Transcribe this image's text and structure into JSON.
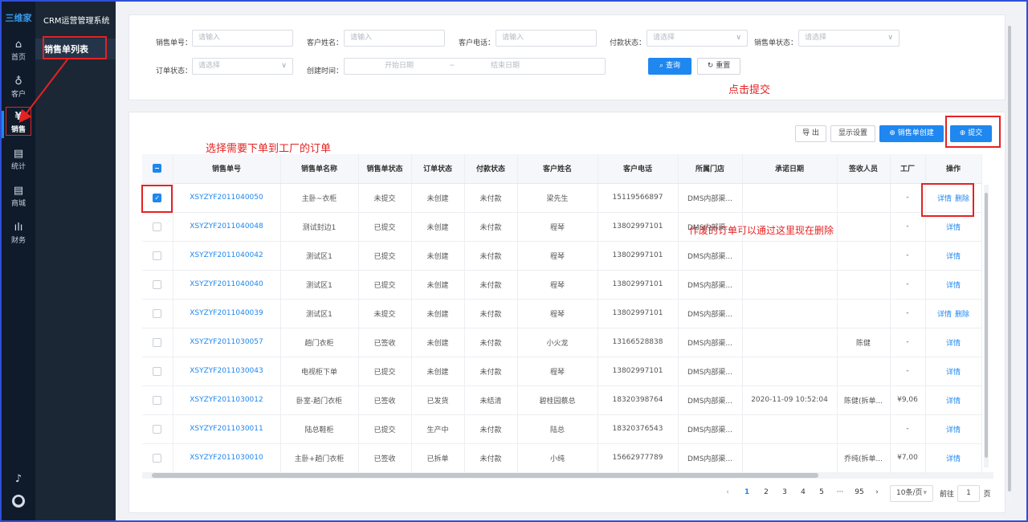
{
  "sidebar": {
    "logo": "三维家",
    "app_title": "CRM运营管理系统",
    "items": [
      {
        "label": "首页",
        "icon": "home-icon"
      },
      {
        "label": "客户",
        "icon": "users-icon"
      },
      {
        "label": "销售",
        "icon": "yen-icon"
      },
      {
        "label": "统计",
        "icon": "document-icon"
      },
      {
        "label": "商城",
        "icon": "document-icon"
      },
      {
        "label": "财务",
        "icon": "bar-chart-icon"
      }
    ],
    "active_sub": "销售单列表"
  },
  "filters": {
    "order_no": {
      "label": "销售单号：",
      "placeholder": "请输入"
    },
    "customer_name": {
      "label": "客户姓名：",
      "placeholder": "请输入"
    },
    "customer_phone": {
      "label": "客户电话：",
      "placeholder": "请输入"
    },
    "payment_status": {
      "label": "付款状态：",
      "placeholder": "请选择"
    },
    "sales_status": {
      "label": "销售单状态：",
      "placeholder": "请选择"
    },
    "order_status": {
      "label": "订单状态：",
      "placeholder": "请选择"
    },
    "created_time": {
      "label": "创建时间：",
      "start": "开始日期",
      "sep": "~",
      "end": "结束日期"
    },
    "query_button": "查询",
    "reset_button": "重置"
  },
  "toolbar": {
    "export": "导 出",
    "display_settings": "显示设置",
    "create": "销售单创建",
    "submit": "提交"
  },
  "annotations": {
    "select_hint": "选择需要下单到工厂的订单",
    "submit_hint": "点击提交",
    "delete_hint": "作废的订单可以通过这里现在删除"
  },
  "table": {
    "headers": [
      "销售单号",
      "销售单名称",
      "销售单状态",
      "订单状态",
      "付款状态",
      "客户姓名",
      "客户电话",
      "所属门店",
      "承诺日期",
      "签收人员",
      "工厂",
      "操作"
    ],
    "rows": [
      {
        "checked": true,
        "no": "XSYZYF2011040050",
        "name": "主卧~衣柜",
        "sales_status": "未提交",
        "order_status": "未创建",
        "pay": "未付款",
        "customer": "梁先生",
        "phone": "15119566897",
        "store": "DMS内部渠...",
        "date": "",
        "signer": "",
        "factory": "-",
        "ops": [
          "详情",
          "删除"
        ]
      },
      {
        "checked": false,
        "no": "XSYZYF2011040048",
        "name": "测试封边1",
        "sales_status": "已提交",
        "order_status": "未创建",
        "pay": "未付款",
        "customer": "程琴",
        "phone": "13802997101",
        "store": "DMS内部渠...",
        "date": "",
        "signer": "",
        "factory": "-",
        "ops": [
          "详情"
        ]
      },
      {
        "checked": false,
        "no": "XSYZYF2011040042",
        "name": "测试区1",
        "sales_status": "已提交",
        "order_status": "未创建",
        "pay": "未付款",
        "customer": "程琴",
        "phone": "13802997101",
        "store": "DMS内部渠...",
        "date": "",
        "signer": "",
        "factory": "-",
        "ops": [
          "详情"
        ]
      },
      {
        "checked": false,
        "no": "XSYZYF2011040040",
        "name": "测试区1",
        "sales_status": "已提交",
        "order_status": "未创建",
        "pay": "未付款",
        "customer": "程琴",
        "phone": "13802997101",
        "store": "DMS内部渠...",
        "date": "",
        "signer": "",
        "factory": "-",
        "ops": [
          "详情"
        ]
      },
      {
        "checked": false,
        "no": "XSYZYF2011040039",
        "name": "测试区1",
        "sales_status": "未提交",
        "order_status": "未创建",
        "pay": "未付款",
        "customer": "程琴",
        "phone": "13802997101",
        "store": "DMS内部渠...",
        "date": "",
        "signer": "",
        "factory": "-",
        "ops": [
          "详情",
          "删除"
        ]
      },
      {
        "checked": false,
        "no": "XSYZYF2011030057",
        "name": "趟门衣柜",
        "sales_status": "已签收",
        "order_status": "未创建",
        "pay": "未付款",
        "customer": "小火龙",
        "phone": "13166528838",
        "store": "DMS内部渠...",
        "date": "",
        "signer": "陈健",
        "factory": "-",
        "ops": [
          "详情"
        ]
      },
      {
        "checked": false,
        "no": "XSYZYF2011030043",
        "name": "电视柜下单",
        "sales_status": "已提交",
        "order_status": "未创建",
        "pay": "未付款",
        "customer": "程琴",
        "phone": "13802997101",
        "store": "DMS内部渠...",
        "date": "",
        "signer": "",
        "factory": "-",
        "ops": [
          "详情"
        ]
      },
      {
        "checked": false,
        "no": "XSYZYF2011030012",
        "name": "卧室-趟门衣柜",
        "sales_status": "已签收",
        "order_status": "已发货",
        "pay": "未结清",
        "customer": "碧桂园蔡总",
        "phone": "18320398764",
        "store": "DMS内部渠...",
        "date": "2020-11-09 10:52:04",
        "signer": "陈健(拆单...",
        "factory": "¥9,06",
        "ops": [
          "详情"
        ]
      },
      {
        "checked": false,
        "no": "XSYZYF2011030011",
        "name": "陆总鞋柜",
        "sales_status": "已提交",
        "order_status": "生产中",
        "pay": "未付款",
        "customer": "陆总",
        "phone": "18320376543",
        "store": "DMS内部渠...",
        "date": "",
        "signer": "",
        "factory": "-",
        "ops": [
          "详情"
        ]
      },
      {
        "checked": false,
        "no": "XSYZYF2011030010",
        "name": "主卧+趟门衣柜",
        "sales_status": "已签收",
        "order_status": "已拆单",
        "pay": "未付款",
        "customer": "小纯",
        "phone": "15662977789",
        "store": "DMS内部渠...",
        "date": "",
        "signer": "乔纯(拆单...",
        "factory": "¥7,00",
        "ops": [
          "详情"
        ]
      }
    ]
  },
  "pagination": {
    "pages": [
      "1",
      "2",
      "3",
      "4",
      "5",
      "···",
      "95"
    ],
    "current": "1",
    "page_size": "10条/页",
    "goto_label": "前往",
    "goto_value": "1",
    "goto_suffix": "页"
  }
}
